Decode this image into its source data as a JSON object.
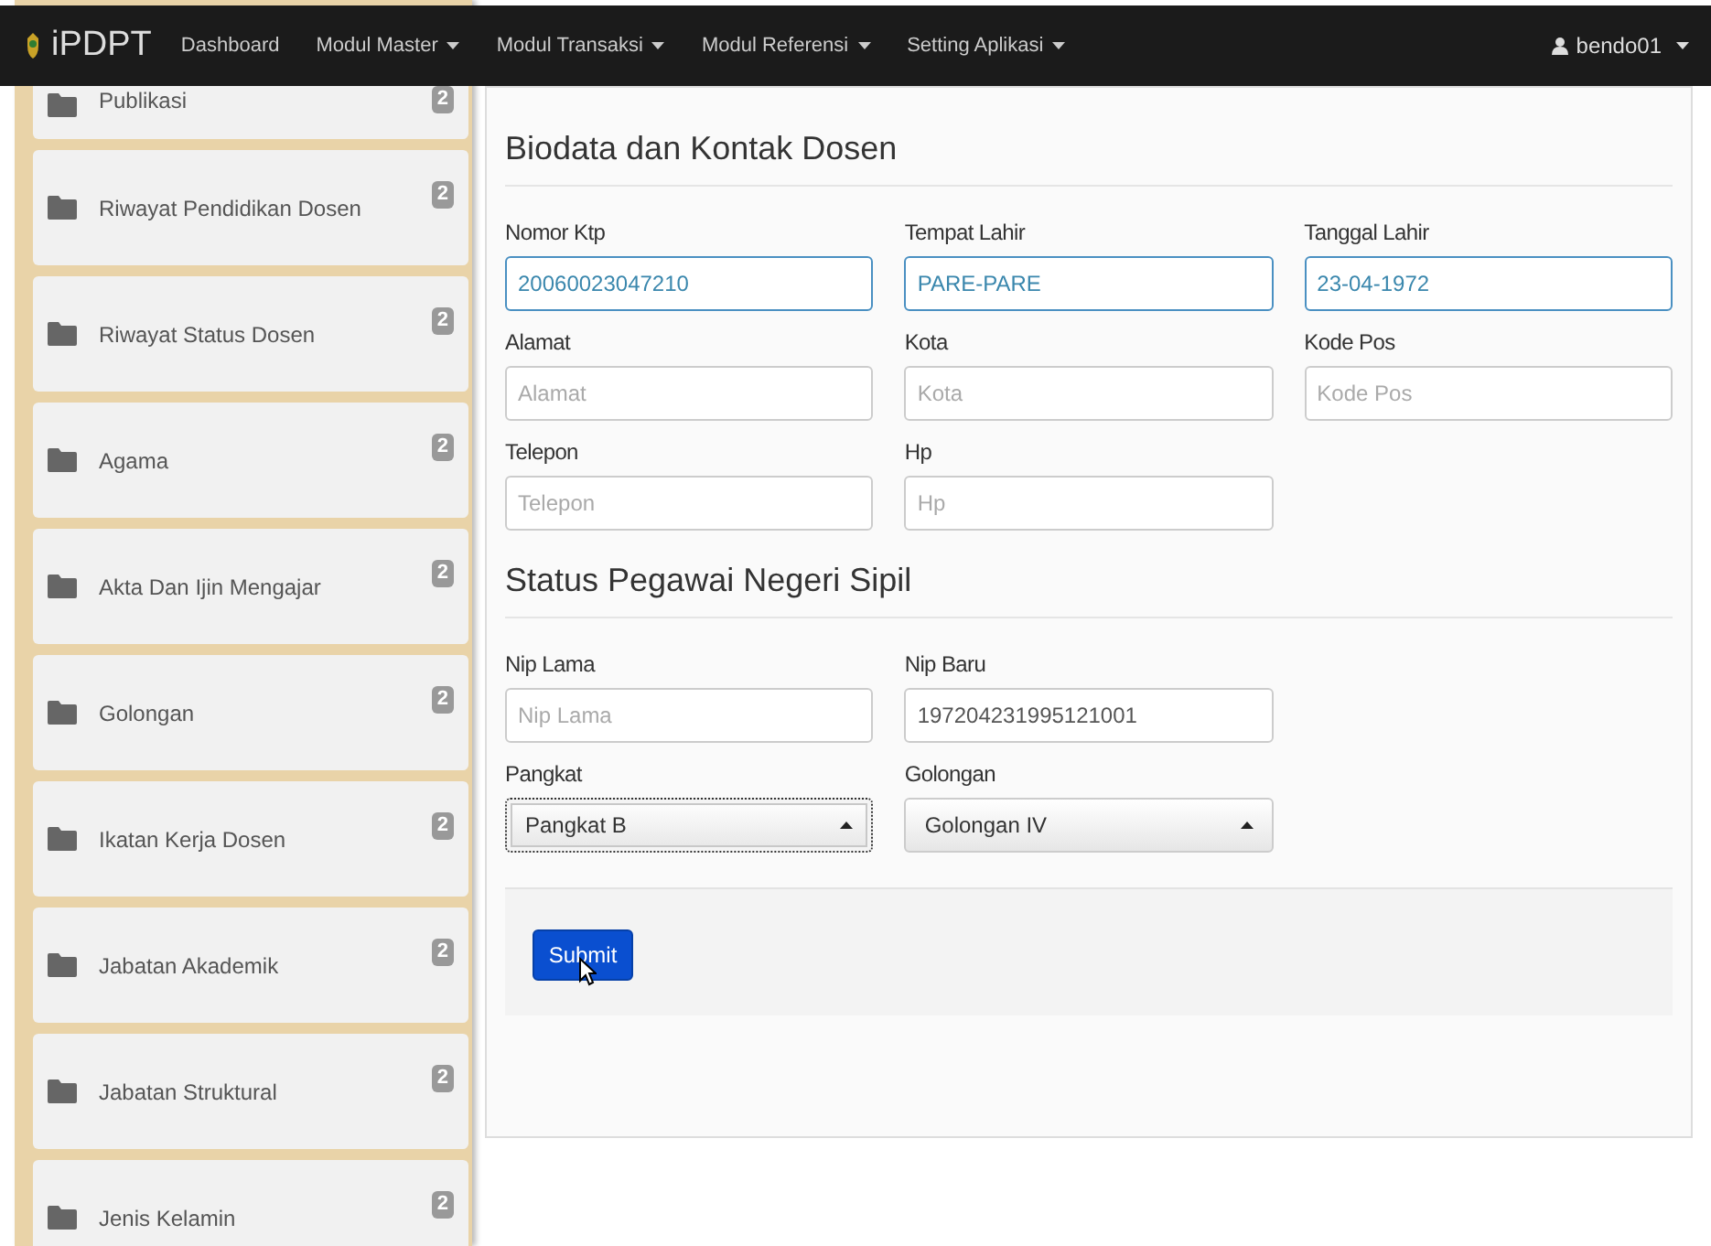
{
  "navbar": {
    "brand": "iPDPT",
    "menus": [
      {
        "label": "Dashboard",
        "dropdown": false
      },
      {
        "label": "Modul Master",
        "dropdown": true
      },
      {
        "label": "Modul Transaksi",
        "dropdown": true
      },
      {
        "label": "Modul Referensi",
        "dropdown": true
      },
      {
        "label": "Setting Aplikasi",
        "dropdown": true
      }
    ],
    "user": "bendo01"
  },
  "sidebar": {
    "items": [
      {
        "label": "Publikasi",
        "badge": "2"
      },
      {
        "label": "Riwayat Pendidikan Dosen",
        "badge": "2"
      },
      {
        "label": "Riwayat Status Dosen",
        "badge": "2"
      },
      {
        "label": "Agama",
        "badge": "2"
      },
      {
        "label": "Akta Dan Ijin Mengajar",
        "badge": "2"
      },
      {
        "label": "Golongan",
        "badge": "2"
      },
      {
        "label": "Ikatan Kerja Dosen",
        "badge": "2"
      },
      {
        "label": "Jabatan Akademik",
        "badge": "2"
      },
      {
        "label": "Jabatan Struktural",
        "badge": "2"
      },
      {
        "label": "Jenis Kelamin",
        "badge": "2"
      }
    ]
  },
  "sections": [
    {
      "title": "Biodata dan Kontak Dosen",
      "rows": [
        [
          {
            "label": "Nomor Ktp",
            "kind": "text",
            "value": "20060023047210",
            "highlighted": true
          },
          {
            "label": "Tempat Lahir",
            "kind": "text",
            "value": "PARE-PARE",
            "highlighted": true
          },
          {
            "label": "Tanggal Lahir",
            "kind": "text",
            "value": "23-04-1972",
            "highlighted": true
          }
        ],
        [
          {
            "label": "Alamat",
            "kind": "text",
            "placeholder": "Alamat",
            "highlighted": false
          },
          {
            "label": "Kota",
            "kind": "text",
            "placeholder": "Kota",
            "highlighted": false
          },
          {
            "label": "Kode Pos",
            "kind": "text",
            "placeholder": "Kode Pos",
            "highlighted": false
          }
        ],
        [
          {
            "label": "Telepon",
            "kind": "text",
            "placeholder": "Telepon",
            "highlighted": false
          },
          {
            "label": "Hp",
            "kind": "text",
            "placeholder": "Hp",
            "highlighted": false
          }
        ]
      ]
    },
    {
      "title": "Status Pegawai Negeri Sipil",
      "rows": [
        [
          {
            "label": "Nip Lama",
            "kind": "text",
            "placeholder": "Nip Lama",
            "highlighted": false
          },
          {
            "label": "Nip Baru",
            "kind": "text",
            "value": "197204231995121001",
            "highlighted": false
          }
        ],
        [
          {
            "label": "Pangkat",
            "kind": "select",
            "value": "Pangkat B",
            "focused": true
          },
          {
            "label": "Golongan",
            "kind": "select",
            "value": "Golongan IV",
            "focused": false
          }
        ]
      ]
    }
  ],
  "submit": {
    "label": "Submit"
  }
}
